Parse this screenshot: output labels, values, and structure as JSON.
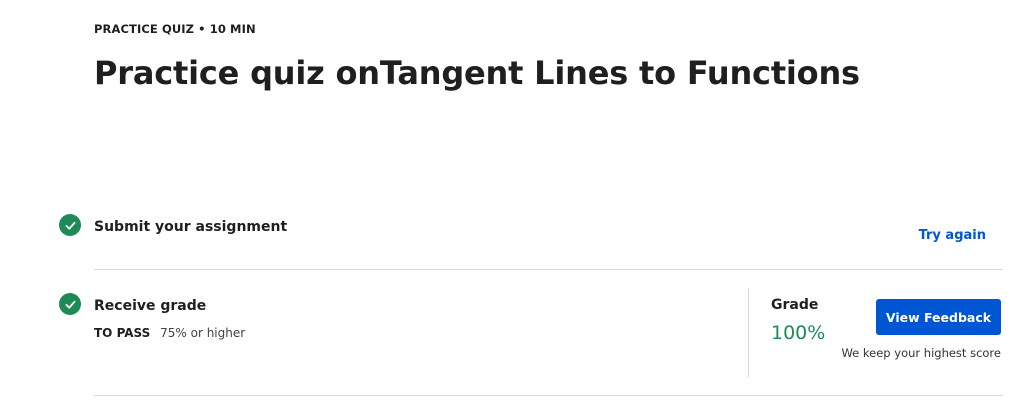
{
  "header": {
    "eyebrow": "PRACTICE QUIZ • 10 MIN",
    "title": "Practice quiz onTangent Lines to Functions"
  },
  "steps": [
    {
      "label": "Submit your assignment",
      "status": "complete",
      "icon": "check-circle-icon"
    },
    {
      "label": "Receive grade",
      "status": "complete",
      "icon": "check-circle-icon"
    }
  ],
  "actions": {
    "try_again": "Try again",
    "view_feedback": "View Feedback"
  },
  "pass": {
    "label": "TO PASS",
    "threshold": "75% or higher"
  },
  "grade": {
    "label": "Grade",
    "value": "100%",
    "note": "We keep your highest score"
  },
  "colors": {
    "success": "#1e8a55",
    "primary": "#0056d2"
  }
}
